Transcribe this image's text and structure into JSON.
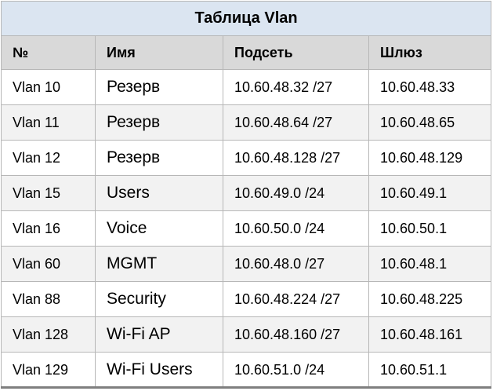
{
  "table": {
    "title": "Таблица Vlan",
    "columns": [
      "№",
      "Имя",
      "Подсеть",
      "Шлюз"
    ],
    "rows": [
      {
        "num": "Vlan 10",
        "name": "Резерв",
        "subnet": "10.60.48.32 /27",
        "gateway": "10.60.48.33"
      },
      {
        "num": "Vlan 11",
        "name": "Резерв",
        "subnet": "10.60.48.64 /27",
        "gateway": "10.60.48.65"
      },
      {
        "num": "Vlan 12",
        "name": "Резерв",
        "subnet": "10.60.48.128 /27",
        "gateway": "10.60.48.129"
      },
      {
        "num": "Vlan 15",
        "name": "Users",
        "subnet": "10.60.49.0 /24",
        "gateway": "10.60.49.1"
      },
      {
        "num": "Vlan 16",
        "name": "Voice",
        "subnet": "10.60.50.0 /24",
        "gateway": "10.60.50.1"
      },
      {
        "num": "Vlan 60",
        "name": "MGMT",
        "subnet": "10.60.48.0 /27",
        "gateway": "10.60.48.1"
      },
      {
        "num": "Vlan 88",
        "name": "Security",
        "subnet": "10.60.48.224 /27",
        "gateway": "10.60.48.225"
      },
      {
        "num": "Vlan 128",
        "name": "Wi-Fi AP",
        "subnet": "10.60.48.160 /27",
        "gateway": "10.60.48.161"
      },
      {
        "num": "Vlan 129",
        "name": "Wi-Fi Users",
        "subnet": "10.60.51.0 /24",
        "gateway": "10.60.51.1"
      }
    ]
  },
  "colors": {
    "title_bg": "#dbe5f1",
    "header_bg": "#d9d9d9",
    "row_alt_bg": "#f2f2f2",
    "border": "#b7b7b7"
  }
}
